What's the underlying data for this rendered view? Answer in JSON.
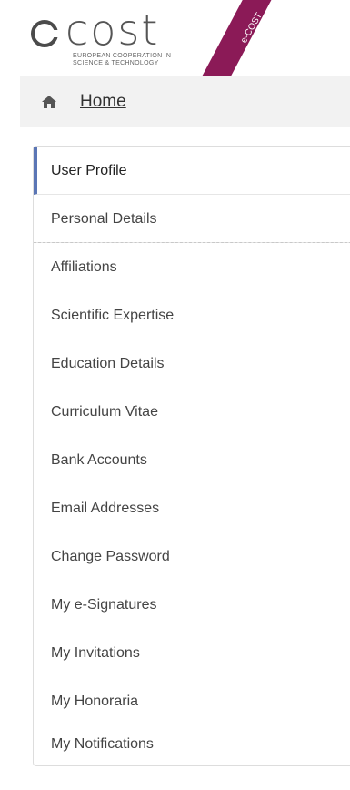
{
  "header": {
    "logo_text": "cost",
    "logo_subtitle": "EUROPEAN COOPERATION IN SCIENCE & TECHNOLOGY",
    "badge": "e-COST",
    "badge_color": "#8b1a57"
  },
  "breadcrumb": {
    "icon": "home-icon",
    "label": "Home"
  },
  "menu": {
    "accent_color": "#5b76b5",
    "items": [
      {
        "label": "User Profile"
      },
      {
        "label": "Personal Details"
      },
      {
        "label": "Affiliations"
      },
      {
        "label": "Scientific Expertise"
      },
      {
        "label": "Education Details"
      },
      {
        "label": "Curriculum Vitae"
      },
      {
        "label": "Bank Accounts"
      },
      {
        "label": "Email Addresses"
      },
      {
        "label": "Change Password"
      },
      {
        "label": "My e-Signatures"
      },
      {
        "label": "My Invitations"
      },
      {
        "label": "My Honoraria"
      },
      {
        "label": "My Notifications"
      }
    ]
  }
}
